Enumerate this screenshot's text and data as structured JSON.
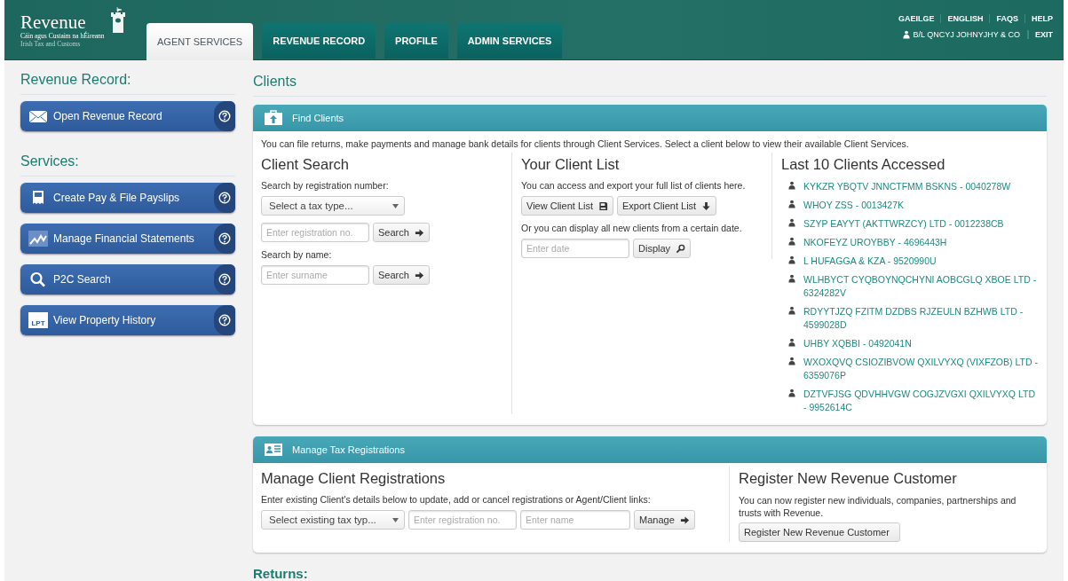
{
  "logo": {
    "name": "Revenue",
    "line1": "Cáin agus Custaim na hÉireann",
    "line2": "Irish Tax and Customs"
  },
  "tabs": [
    {
      "label": "AGENT SERVICES",
      "selected": true
    },
    {
      "label": "REVENUE RECORD",
      "selected": false
    },
    {
      "label": "PROFILE",
      "selected": false
    },
    {
      "label": "ADMIN SERVICES",
      "selected": false
    }
  ],
  "top_links": [
    "GAEILGE",
    "ENGLISH",
    "FAQS",
    "HELP"
  ],
  "user": {
    "name": "B/L QNCYJ JOHNYJHY & CO",
    "exit": "EXIT"
  },
  "sidebar": [
    {
      "title": "Revenue Record:",
      "items": [
        {
          "label": "Open Revenue Record",
          "kind": "envelope"
        }
      ]
    },
    {
      "title": "Services:",
      "items": [
        {
          "label": "Create Pay & File Payslips",
          "kind": "payslip"
        },
        {
          "label": "Manage Financial Statements",
          "kind": "chart"
        },
        {
          "label": "P2C Search",
          "kind": "search"
        },
        {
          "label": "View Property History",
          "kind": "badge",
          "icon_text": "LPT"
        }
      ]
    }
  ],
  "page_title": "Clients",
  "find_clients": {
    "title": "Find Clients",
    "intro": "You can file returns, make payments and manage bank details for clients through Client Services. Select a client below to view their available Client Services.",
    "client_search": {
      "title": "Client Search",
      "reg_label": "Search by registration number:",
      "tax_type_placeholder": "Select a tax type...",
      "reg_placeholder": "Enter registration no.",
      "reg_button": "Search",
      "name_label": "Search by name:",
      "name_placeholder": "Enter surname",
      "name_button": "Search"
    },
    "client_list": {
      "title": "Your Client List",
      "text": "You can access and export your full list of clients here.",
      "view_button": "View Client List",
      "export_button": "Export Client List",
      "date_text": "Or you can display all new clients from a certain date.",
      "date_placeholder": "Enter date",
      "display_button": "Display"
    },
    "last_clients": {
      "title": "Last 10 Clients Accessed",
      "clients": [
        "KYKZR YBQTV JNNCTFMM BSKNS - 0040278W",
        "WHOY ZSS - 0013427K",
        "SZYP EAYYT (AKTTWRZCY) LTD - 0012238CB",
        "NKOFEYZ UROYBBY - 4696443H",
        "L HUFAGGA & KZA - 9520990U",
        "WLHBYCT CYQBOYNQCHYNI AOBCGLQ XBOE LTD - 6324282V",
        "RDYYTJZQ FZITM DZDBS RJZEULN BZHWB LTD - 4599028D",
        "UHBY XQBBI - 0492041N",
        "WXOXQVQ CSIOZIBVOW QXILVYXQ (VIXFZOB) LTD - 6359076P",
        "DZTVFJSG QDVHHVGW COGJZVGXI QXILVYXQ LTD - 9952614C"
      ]
    }
  },
  "manage_registrations": {
    "title": "Manage Tax Registrations",
    "manage": {
      "title": "Manage Client Registrations",
      "text": "Enter existing Client's details below to update, add or cancel registrations or Agent/Client links:",
      "tax_type_placeholder": "Select existing tax typ...",
      "reg_placeholder": "Enter registration no.",
      "name_placeholder": "Enter name",
      "button": "Manage"
    },
    "register": {
      "title": "Register New Revenue Customer",
      "text": "You can now register new individuals, companies, partnerships and trusts with Revenue.",
      "button": "Register New Revenue Customer"
    }
  },
  "returns_title": "Returns:"
}
